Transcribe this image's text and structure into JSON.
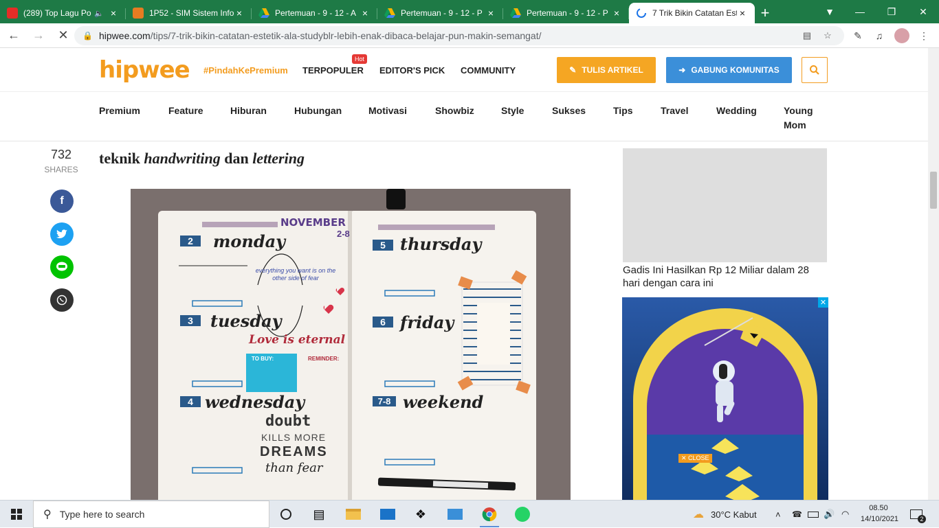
{
  "browser": {
    "tabs": [
      {
        "title": "(289) Top Lagu Po",
        "color": "#e52d27"
      },
      {
        "title": "1P52 - SIM Sistem Info",
        "color": "#e67c22"
      },
      {
        "title": "Pertemuan - 9 - 12 - A",
        "color": "#f4b400"
      },
      {
        "title": "Pertemuan - 9 - 12 - P",
        "color": "#f4b400"
      },
      {
        "title": "Pertemuan - 9 - 12 - P",
        "color": "#f4b400"
      },
      {
        "title": "7 Trik Bikin Catatan Est",
        "color": "#888888"
      }
    ],
    "url_domain": "hipwee.com",
    "url_path": "/tips/7-trik-bikin-catatan-estetik-ala-studyblr-lebih-enak-dibaca-belajar-pun-makin-semangat/"
  },
  "header": {
    "logo": "hipwee",
    "promo": "#PindahKePremium",
    "nav": [
      "TERPOPULER",
      "EDITOR'S PICK",
      "COMMUNITY"
    ],
    "hot_badge": "Hot",
    "write_btn": "TULIS ARTIKEL",
    "join_btn": "GABUNG KOMUNITAS"
  },
  "categories": [
    "Premium",
    "Feature",
    "Hiburan",
    "Hubungan",
    "Motivasi",
    "Showbiz",
    "Style",
    "Sukses",
    "Tips",
    "Travel",
    "Wedding",
    "Young Mom"
  ],
  "article": {
    "shares_count": "732",
    "shares_label": "SHARES",
    "lead_pre": "teknik ",
    "lead_em1": "handwriting",
    "lead_mid": " dan ",
    "lead_em2": "lettering",
    "journal": {
      "month": "NOVEMBER",
      "week": "2-8",
      "days": [
        "monday",
        "tuesday",
        "wednesday",
        "thursday",
        "friday",
        "weekend"
      ],
      "day_nums": [
        "2",
        "3",
        "4",
        "5",
        "6",
        "7-8"
      ],
      "quote_center": "everything you want is on the other side of fear",
      "love": "Love is eternal",
      "doubt": [
        "doubt",
        "KILLS MORE",
        "DREAMS",
        "than fear"
      ],
      "todo_title": "TO BUY:",
      "reminder_title": "REMINDER:"
    }
  },
  "sidebar": {
    "ad_caption": "Gadis Ini Hasilkan Rp 12 Miliar dalam 28 hari dengan cara ini",
    "ad_close": "CLOSE"
  },
  "taskbar": {
    "search_placeholder": "Type here to search",
    "weather": "30°C  Kabut",
    "time": "08.50",
    "date": "14/10/2021",
    "notifications": "2"
  }
}
